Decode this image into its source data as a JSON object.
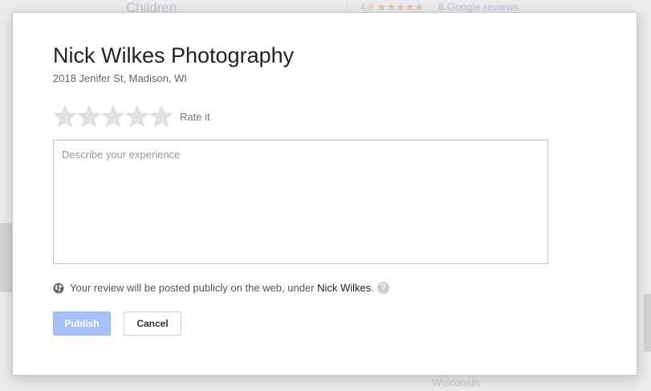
{
  "background": {
    "heading_children": "Children",
    "rating_value": "4.8",
    "rating_stars": "★★★★★",
    "reviews_link": "6 Google reviews",
    "location": "Wisconsin"
  },
  "dialog": {
    "business_name": "Nick Wilkes Photography",
    "address": "2018 Jenifer St, Madison, WI",
    "rate_label": "Rate it",
    "review_placeholder": "Describe your experience",
    "review_value": "",
    "notice_text": "Your review will be posted publicly on the web, under ",
    "notice_user": "Nick Wilkes",
    "notice_end": ".",
    "help_glyph": "?",
    "publish_label": "Publish",
    "cancel_label": "Cancel"
  },
  "colors": {
    "publish_button": "#a6c1f7",
    "star_empty": "#e3e3e3",
    "backdrop": "#ececec"
  },
  "icons": [
    "star-icon",
    "globe-icon",
    "help-icon"
  ]
}
